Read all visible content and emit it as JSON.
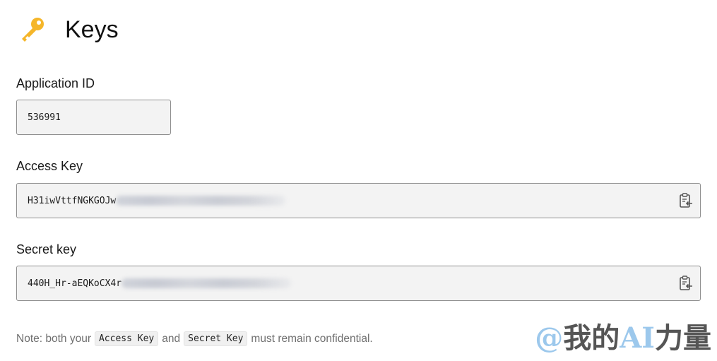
{
  "header": {
    "title": "Keys",
    "icon": "key-icon",
    "icon_color": "#f5b62a"
  },
  "fields": {
    "application_id": {
      "label": "Application ID",
      "value": "536991"
    },
    "access_key": {
      "label": "Access Key",
      "value_visible": "H31iwVttfNGKGOJw",
      "value_redacted": true,
      "copy_icon": "clipboard-copy-icon"
    },
    "secret_key": {
      "label": "Secret key",
      "value_visible": "440H_Hr-aEQKoCX4r",
      "value_redacted": true,
      "copy_icon": "clipboard-copy-icon"
    }
  },
  "note": {
    "prefix": "Note: both your",
    "chip1": "Access Key",
    "middle": "and",
    "chip2": "Secret Key",
    "suffix": "must remain confidential."
  },
  "watermark": {
    "at": "@",
    "part1": "我的",
    "ai": "AI",
    "part2": "力量"
  },
  "colors": {
    "field_background": "#f3f3f3",
    "field_border": "#8f8f8f",
    "note_text": "#6f6f6f",
    "watermark_accent": "#9cc8ec"
  }
}
